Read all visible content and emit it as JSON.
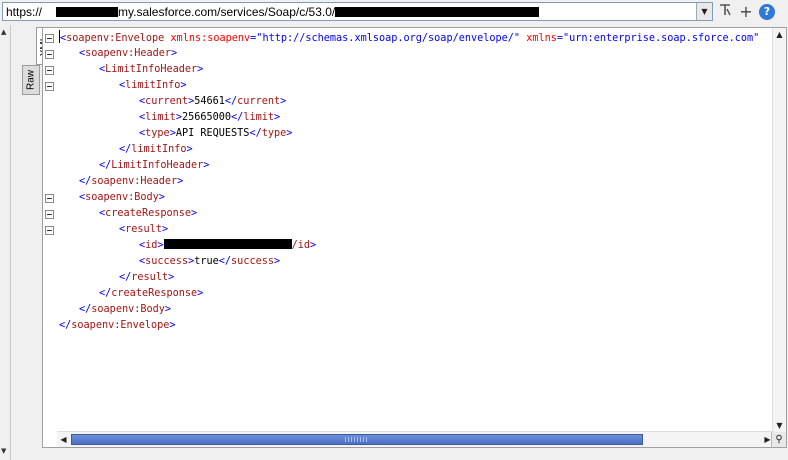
{
  "urlbar": {
    "url_prefix": "https://",
    "url_middle": "my.salesforce.com/services/Soap/c/53.0/",
    "dropdown_icon": "chevron-down-icon",
    "bookmark_icon": "bookmark-icon",
    "add_icon": "plus-icon",
    "add_label": "+",
    "help_label": "?"
  },
  "tabs": {
    "xml": "XML",
    "raw": "Raw"
  },
  "xml_lines": [
    {
      "indent": 0,
      "parts": [
        [
          "b",
          "<"
        ],
        [
          "t",
          "soapenv:Envelope"
        ],
        [
          "tx",
          " "
        ],
        [
          "an",
          "xmlns:soapenv"
        ],
        [
          "b",
          "=\""
        ],
        [
          "av",
          "http://schemas.xmlsoap.org/soap/envelope/"
        ],
        [
          "b",
          "\""
        ],
        [
          "tx",
          " "
        ],
        [
          "an",
          "xmlns"
        ],
        [
          "b",
          "=\""
        ],
        [
          "av",
          "urn:enterprise.soap.sforce.com"
        ],
        [
          "b",
          "\""
        ]
      ]
    },
    {
      "indent": 1,
      "parts": [
        [
          "b",
          "<"
        ],
        [
          "t",
          "soapenv:Header"
        ],
        [
          "b",
          ">"
        ]
      ]
    },
    {
      "indent": 2,
      "parts": [
        [
          "b",
          "<"
        ],
        [
          "t",
          "LimitInfoHeader"
        ],
        [
          "b",
          ">"
        ]
      ]
    },
    {
      "indent": 3,
      "parts": [
        [
          "b",
          "<"
        ],
        [
          "t",
          "limitInfo"
        ],
        [
          "b",
          ">"
        ]
      ]
    },
    {
      "indent": 4,
      "parts": [
        [
          "b",
          "<"
        ],
        [
          "t",
          "current"
        ],
        [
          "b",
          ">"
        ],
        [
          "tx",
          "54661"
        ],
        [
          "b",
          "</"
        ],
        [
          "t",
          "current"
        ],
        [
          "b",
          ">"
        ]
      ]
    },
    {
      "indent": 4,
      "parts": [
        [
          "b",
          "<"
        ],
        [
          "t",
          "limit"
        ],
        [
          "b",
          ">"
        ],
        [
          "tx",
          "25665000"
        ],
        [
          "b",
          "</"
        ],
        [
          "t",
          "limit"
        ],
        [
          "b",
          ">"
        ]
      ]
    },
    {
      "indent": 4,
      "parts": [
        [
          "b",
          "<"
        ],
        [
          "t",
          "type"
        ],
        [
          "b",
          ">"
        ],
        [
          "tx",
          "API REQUESTS"
        ],
        [
          "b",
          "</"
        ],
        [
          "t",
          "type"
        ],
        [
          "b",
          ">"
        ]
      ]
    },
    {
      "indent": 3,
      "parts": [
        [
          "b",
          "</"
        ],
        [
          "t",
          "limitInfo"
        ],
        [
          "b",
          ">"
        ]
      ]
    },
    {
      "indent": 2,
      "parts": [
        [
          "b",
          "</"
        ],
        [
          "t",
          "LimitInfoHeader"
        ],
        [
          "b",
          ">"
        ]
      ]
    },
    {
      "indent": 1,
      "parts": [
        [
          "b",
          "</"
        ],
        [
          "t",
          "soapenv:Header"
        ],
        [
          "b",
          ">"
        ]
      ]
    },
    {
      "indent": 1,
      "parts": [
        [
          "b",
          "<"
        ],
        [
          "t",
          "soapenv:Body"
        ],
        [
          "b",
          ">"
        ]
      ]
    },
    {
      "indent": 2,
      "parts": [
        [
          "b",
          "<"
        ],
        [
          "t",
          "createResponse"
        ],
        [
          "b",
          ">"
        ]
      ]
    },
    {
      "indent": 3,
      "parts": [
        [
          "b",
          "<"
        ],
        [
          "t",
          "result"
        ],
        [
          "b",
          ">"
        ]
      ]
    },
    {
      "indent": 4,
      "parts": [
        [
          "b",
          "<"
        ],
        [
          "t",
          "id"
        ],
        [
          "b",
          ">"
        ],
        [
          "redact",
          ""
        ],
        [
          "t",
          "/id"
        ],
        [
          "b",
          ">"
        ]
      ]
    },
    {
      "indent": 4,
      "parts": [
        [
          "b",
          "<"
        ],
        [
          "t",
          "success"
        ],
        [
          "b",
          ">"
        ],
        [
          "tx",
          "true"
        ],
        [
          "b",
          "</"
        ],
        [
          "t",
          "success"
        ],
        [
          "b",
          ">"
        ]
      ]
    },
    {
      "indent": 3,
      "parts": [
        [
          "b",
          "</"
        ],
        [
          "t",
          "result"
        ],
        [
          "b",
          ">"
        ]
      ]
    },
    {
      "indent": 2,
      "parts": [
        [
          "b",
          "</"
        ],
        [
          "t",
          "createResponse"
        ],
        [
          "b",
          ">"
        ]
      ]
    },
    {
      "indent": 1,
      "parts": [
        [
          "b",
          "</"
        ],
        [
          "t",
          "soapenv:Body"
        ],
        [
          "b",
          ">"
        ]
      ]
    },
    {
      "indent": 0,
      "parts": [
        [
          "b",
          "</"
        ],
        [
          "t",
          "soapenv:Envelope"
        ],
        [
          "b",
          ">"
        ]
      ]
    }
  ],
  "fold_lines": [
    0,
    1,
    2,
    3,
    10,
    11,
    12
  ],
  "colors": {
    "bracket": "#0000ff",
    "tag": "#a31515",
    "attr_name": "#ff0000",
    "attr_value": "#0000ff",
    "text": "#000000",
    "scroll_thumb": "#4a70c6"
  }
}
